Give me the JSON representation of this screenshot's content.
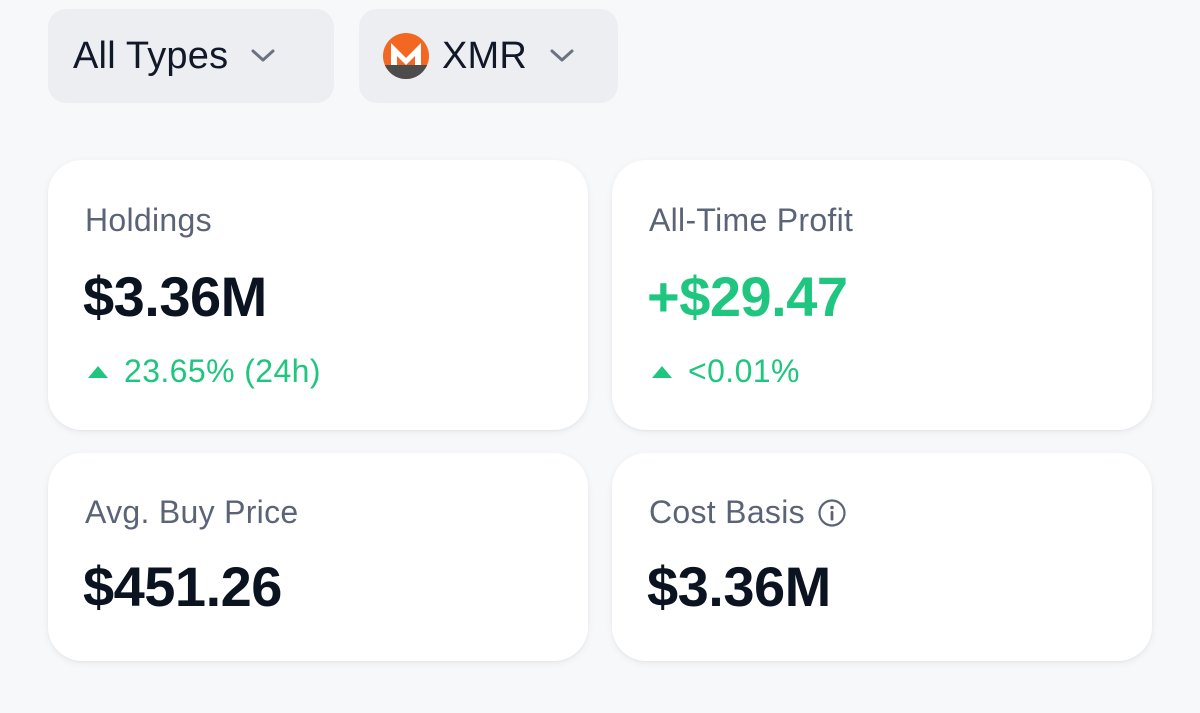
{
  "filters": {
    "type": {
      "label": "All Types",
      "icon": "chevron-down-icon"
    },
    "coin": {
      "label": "XMR",
      "icon": "monero-logo",
      "colors": {
        "orange": "#f26822",
        "gray": "#4c4c4c"
      }
    }
  },
  "cards": {
    "holdings": {
      "label": "Holdings",
      "value": "$3.36M",
      "change": "23.65% (24h)",
      "trend": "up"
    },
    "profit": {
      "label": "All-Time Profit",
      "value": "+$29.47",
      "change": "<0.01%",
      "trend": "up"
    },
    "avg_buy_price": {
      "label": "Avg. Buy Price",
      "value": "$451.26"
    },
    "cost_basis": {
      "label": "Cost Basis",
      "value": "$3.36M",
      "icon": "info-icon"
    }
  },
  "colors": {
    "positive": "#1fc67f",
    "label": "#5b6477",
    "value": "#0b1220",
    "card": "#ffffff",
    "background": "#f7f8fa",
    "filter_bg": "#eceef2"
  }
}
